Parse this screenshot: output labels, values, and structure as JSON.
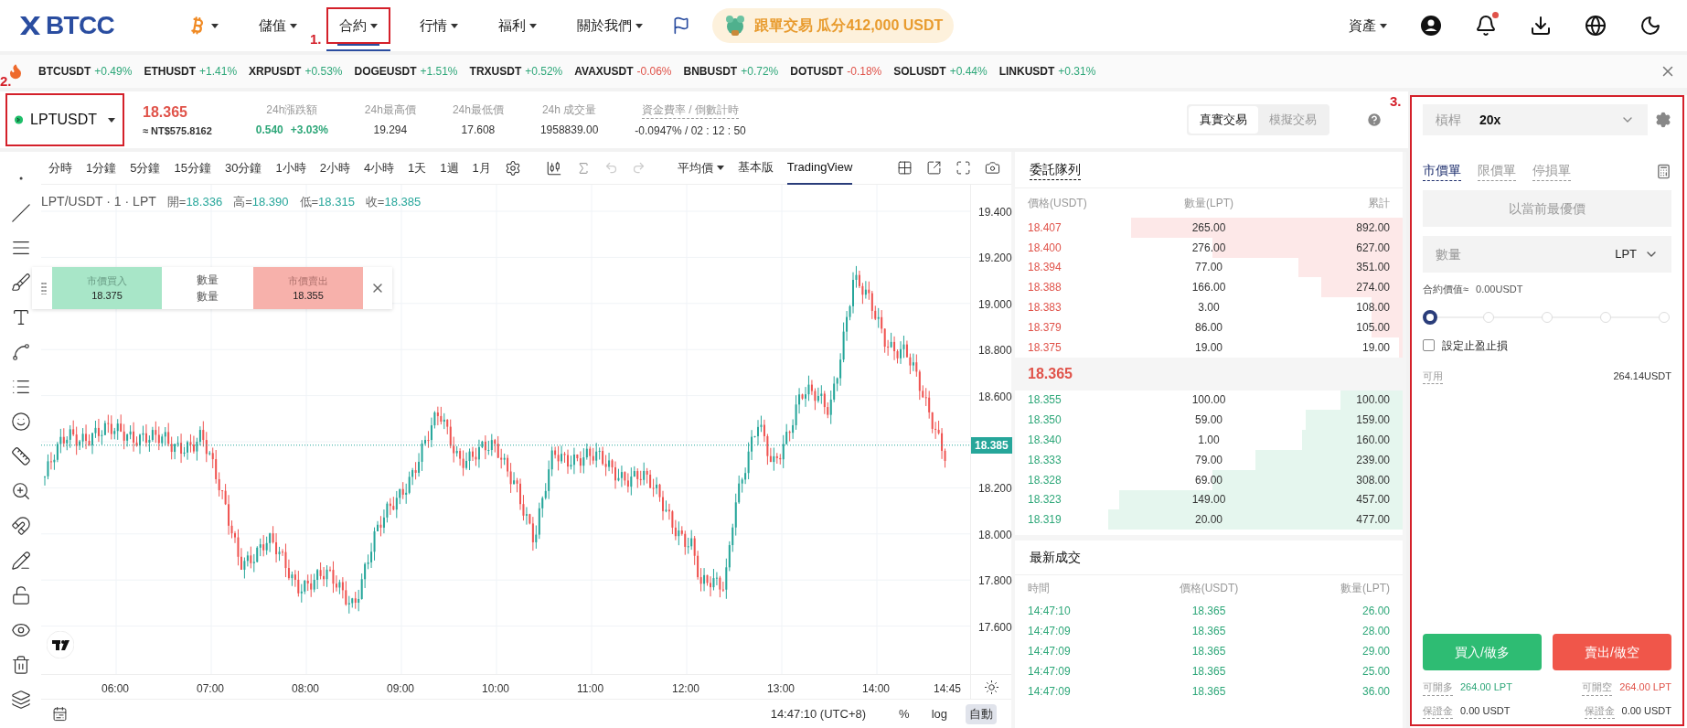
{
  "nav": {
    "logo": "BTCC",
    "items": [
      {
        "label": "儲值",
        "selected": false
      },
      {
        "label": "合約",
        "selected": true,
        "marker": "1."
      },
      {
        "label": "行情",
        "selected": false
      },
      {
        "label": "福利",
        "selected": false
      },
      {
        "label": "關於我們",
        "selected": false
      }
    ],
    "promo": "跟單交易 瓜分412,000 USDT",
    "assets": "資產",
    "unread_notifications": true
  },
  "ticker": [
    {
      "symbol": "BTCUSDT",
      "change": "+0.49%",
      "kind": "up"
    },
    {
      "symbol": "ETHUSDT",
      "change": "+1.41%",
      "kind": "up"
    },
    {
      "symbol": "XRPUSDT",
      "change": "+0.53%",
      "kind": "up"
    },
    {
      "symbol": "DOGEUSDT",
      "change": "+1.51%",
      "kind": "up"
    },
    {
      "symbol": "TRXUSDT",
      "change": "+0.52%",
      "kind": "up"
    },
    {
      "symbol": "AVAXUSDT",
      "change": "-0.06%",
      "kind": "down"
    },
    {
      "symbol": "BNBUSDT",
      "change": "+0.72%",
      "kind": "up"
    },
    {
      "symbol": "DOTUSDT",
      "change": "-0.18%",
      "kind": "down"
    },
    {
      "symbol": "SOLUSDT",
      "change": "+0.44%",
      "kind": "up"
    },
    {
      "symbol": "LINKUSDT",
      "change": "+0.31%",
      "kind": "up"
    }
  ],
  "pair": {
    "symbol": "LPTUSDT",
    "marker": "2.",
    "price": "18.365",
    "fiat": "≈ NT$575.8162"
  },
  "stats": [
    {
      "label": "24h漲跌額",
      "hint": false,
      "values": [
        {
          "text": "0.540",
          "kind": "up"
        },
        {
          "text": "+3.03%",
          "kind": "up"
        }
      ]
    },
    {
      "label": "24h最高價",
      "hint": false,
      "values": [
        {
          "text": "19.294",
          "kind": "plain"
        }
      ]
    },
    {
      "label": "24h最低價",
      "hint": false,
      "values": [
        {
          "text": "17.608",
          "kind": "plain"
        }
      ]
    },
    {
      "label": "24h 成交量",
      "hint": false,
      "values": [
        {
          "text": "1958839.00",
          "kind": "plain"
        }
      ]
    },
    {
      "label": "資金費率 / 倒數計時",
      "hint": true,
      "values": [
        {
          "text": "-0.0947% / 02 : 12 : 50",
          "kind": "plain"
        }
      ]
    }
  ],
  "mode_tabs": [
    {
      "label": "真實交易",
      "selected": true
    },
    {
      "label": "模擬交易",
      "selected": false
    }
  ],
  "chart": {
    "intervals": [
      "分時",
      "1分鐘",
      "5分鐘",
      "15分鐘",
      "30分鐘",
      "1小時",
      "2小時",
      "4小時",
      "1天",
      "1週",
      "1月"
    ],
    "price_type": "平均價",
    "views": [
      {
        "label": "基本版",
        "selected": false
      },
      {
        "label": "TradingView",
        "selected": true
      }
    ],
    "legend": {
      "title": "LPT/USDT · 1 · LPT",
      "ohlc": [
        {
          "label": "開=",
          "value": "18.336"
        },
        {
          "label": "高=",
          "value": "18.390"
        },
        {
          "label": "低=",
          "value": "18.315"
        },
        {
          "label": "收=",
          "value": "18.385"
        }
      ]
    },
    "quick_trade": {
      "buy_label": "市價買入",
      "buy_price": "18.375",
      "amount_label": "數量",
      "amount_placeholder": "數量",
      "sell_label": "市價賣出",
      "sell_price": "18.355"
    },
    "y_labels": [
      "19.400",
      "19.200",
      "19.000",
      "18.800",
      "18.600",
      "18.200",
      "18.000",
      "17.800",
      "17.600"
    ],
    "x_labels": [
      "06:00",
      "07:00",
      "08:00",
      "09:00",
      "10:00",
      "11:00",
      "12:00",
      "13:00",
      "14:00",
      "14:45"
    ],
    "last_price": "18.385",
    "time": "14:47:10 (UTC+8)",
    "scale_buttons": [
      {
        "label": "%",
        "selected": false
      },
      {
        "label": "log",
        "selected": false
      },
      {
        "label": "自動",
        "selected": true
      }
    ]
  },
  "orderbook": {
    "title": "委託隊列",
    "columns": [
      "價格(USDT)",
      "數量(LPT)",
      "累計"
    ],
    "asks": [
      {
        "price": "18.407",
        "amount": "265.00",
        "total": "892.00",
        "level": 0.7
      },
      {
        "price": "18.400",
        "amount": "276.00",
        "total": "627.00",
        "level": 0.49
      },
      {
        "price": "18.394",
        "amount": "77.00",
        "total": "351.00",
        "level": 0.27
      },
      {
        "price": "18.388",
        "amount": "166.00",
        "total": "274.00",
        "level": 0.21
      },
      {
        "price": "18.383",
        "amount": "3.00",
        "total": "108.00",
        "level": 0.08
      },
      {
        "price": "18.379",
        "amount": "86.00",
        "total": "105.00",
        "level": 0.08
      },
      {
        "price": "18.375",
        "amount": "19.00",
        "total": "19.00",
        "level": 0.01
      }
    ],
    "mid": "18.365",
    "bids": [
      {
        "price": "18.355",
        "amount": "100.00",
        "total": "100.00",
        "level": 0.16
      },
      {
        "price": "18.350",
        "amount": "59.00",
        "total": "159.00",
        "level": 0.25
      },
      {
        "price": "18.340",
        "amount": "1.00",
        "total": "160.00",
        "level": 0.26
      },
      {
        "price": "18.333",
        "amount": "79.00",
        "total": "239.00",
        "level": 0.38
      },
      {
        "price": "18.328",
        "amount": "69.00",
        "total": "308.00",
        "level": 0.49
      },
      {
        "price": "18.323",
        "amount": "149.00",
        "total": "457.00",
        "level": 0.73
      },
      {
        "price": "18.319",
        "amount": "20.00",
        "total": "477.00",
        "level": 0.76
      }
    ]
  },
  "trades": {
    "title": "最新成交",
    "columns": [
      "時間",
      "價格(USDT)",
      "數量(LPT)"
    ],
    "rows": [
      {
        "time": "14:47:10",
        "price": "18.365",
        "amount": "26.00"
      },
      {
        "time": "14:47:09",
        "price": "18.365",
        "amount": "28.00"
      },
      {
        "time": "14:47:09",
        "price": "18.365",
        "amount": "29.00"
      },
      {
        "time": "14:47:09",
        "price": "18.365",
        "amount": "25.00"
      },
      {
        "time": "14:47:09",
        "price": "18.365",
        "amount": "36.00"
      }
    ]
  },
  "order_panel": {
    "marker": "3.",
    "leverage_label": "槓桿",
    "leverage": "20x",
    "order_types": [
      {
        "label": "市價單",
        "selected": true
      },
      {
        "label": "限價單",
        "selected": false
      },
      {
        "label": "停損單",
        "selected": false
      }
    ],
    "price_placeholder": "以當前最優價",
    "amount_placeholder": "數量",
    "unit": "LPT",
    "contract_value_label": "合約價值≈",
    "contract_value": "0.00USDT",
    "slider": {
      "level": 0
    },
    "tp_sl": {
      "label": "設定止盈止損",
      "checked": false
    },
    "available_label": "可用",
    "available": "264.14USDT",
    "buy": "買入/做多",
    "sell": "賣出/做空",
    "long_info": [
      {
        "label": "可開多",
        "value": "264.00 LPT",
        "kind": "up"
      },
      {
        "label": "保證金",
        "value": "0.00 USDT",
        "kind": "plain"
      }
    ],
    "short_info": [
      {
        "label": "可開空",
        "value": "264.00 LPT",
        "kind": "down"
      },
      {
        "label": "保證金",
        "value": "0.00 USDT",
        "kind": "plain"
      }
    ]
  }
}
